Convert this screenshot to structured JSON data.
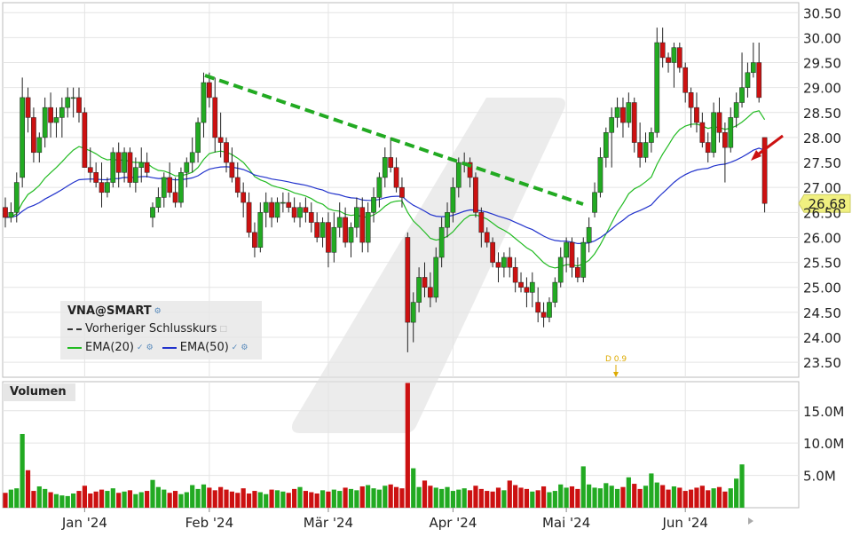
{
  "symbol": "VNA@SMART",
  "legend": {
    "title": "VNA@SMART",
    "items": [
      {
        "label": "Vorheriger Schlusskurs",
        "color": "#333333",
        "style": "dashed"
      },
      {
        "label": "EMA(20)",
        "color": "#22bb22",
        "style": "solid"
      },
      {
        "label": "EMA(50)",
        "color": "#2233cc",
        "style": "solid"
      }
    ]
  },
  "volume_panel_label": "Volumen",
  "colors": {
    "up": "#22aa22",
    "down": "#cc1111",
    "ema20": "#22bb22",
    "ema50": "#2233cc",
    "trend": "#22aa22",
    "arrow": "#cc1111",
    "last_price_bg": "#f0f080",
    "dividend": "#ddaa00"
  },
  "last_price_label": "26.68",
  "dividend_label": "D 0.9",
  "chart_data": {
    "type": "candlestick",
    "price_axis": {
      "ticks": [
        "30.50",
        "30.00",
        "29.50",
        "29.00",
        "28.50",
        "28.00",
        "27.50",
        "27.00",
        "26.50",
        "26.00",
        "25.50",
        "25.00",
        "24.50",
        "24.00",
        "23.50"
      ],
      "range": [
        23.2,
        30.7
      ]
    },
    "volume_axis": {
      "ticks": [
        "15.0M",
        "10.0M",
        "5.0M"
      ],
      "range": [
        0,
        19.5
      ]
    },
    "x_axis": {
      "ticks": [
        "Jan '24",
        "Feb '24",
        "Mär '24",
        "Apr '24",
        "Mai '24",
        "Jun '24"
      ],
      "tick_index": [
        14,
        36,
        57,
        79,
        99,
        120
      ]
    },
    "ohlc": [
      [
        26.6,
        26.8,
        26.2,
        26.4
      ],
      [
        26.4,
        26.7,
        26.3,
        26.5
      ],
      [
        26.5,
        27.3,
        26.3,
        27.1
      ],
      [
        27.2,
        29.2,
        27.0,
        28.8
      ],
      [
        28.8,
        29.0,
        28.1,
        28.4
      ],
      [
        28.4,
        28.6,
        27.5,
        27.7
      ],
      [
        27.7,
        28.1,
        27.5,
        28.0
      ],
      [
        28.0,
        28.8,
        27.8,
        28.6
      ],
      [
        28.6,
        28.9,
        28.0,
        28.3
      ],
      [
        28.3,
        28.6,
        28.0,
        28.4
      ],
      [
        28.4,
        28.8,
        28.0,
        28.6
      ],
      [
        28.6,
        29.0,
        28.4,
        28.8
      ],
      [
        28.8,
        29.0,
        28.4,
        28.8
      ],
      [
        28.8,
        29.0,
        28.3,
        28.5
      ],
      [
        28.5,
        28.6,
        27.4,
        27.4
      ],
      [
        27.4,
        27.8,
        27.1,
        27.3
      ],
      [
        27.3,
        27.5,
        27.0,
        27.1
      ],
      [
        27.1,
        27.5,
        26.6,
        26.9
      ],
      [
        26.9,
        27.2,
        26.8,
        27.1
      ],
      [
        27.1,
        27.8,
        27.0,
        27.7
      ],
      [
        27.7,
        27.9,
        27.0,
        27.3
      ],
      [
        27.3,
        27.8,
        27.1,
        27.7
      ],
      [
        27.7,
        27.8,
        27.0,
        27.1
      ],
      [
        27.1,
        27.6,
        26.9,
        27.4
      ],
      [
        27.4,
        27.8,
        27.1,
        27.5
      ],
      [
        27.5,
        27.7,
        27.2,
        27.3
      ],
      [
        26.4,
        26.7,
        26.2,
        26.6
      ],
      [
        26.6,
        27.0,
        26.5,
        26.8
      ],
      [
        26.8,
        27.3,
        26.6,
        27.2
      ],
      [
        27.2,
        27.5,
        26.8,
        26.9
      ],
      [
        26.9,
        27.2,
        26.6,
        26.7
      ],
      [
        26.7,
        27.4,
        26.6,
        27.3
      ],
      [
        27.3,
        27.6,
        27.0,
        27.5
      ],
      [
        27.5,
        28.0,
        27.3,
        27.7
      ],
      [
        27.7,
        28.4,
        27.5,
        28.3
      ],
      [
        28.3,
        29.3,
        28.0,
        29.1
      ],
      [
        29.1,
        29.3,
        28.6,
        28.8
      ],
      [
        28.8,
        29.2,
        27.7,
        28.0
      ],
      [
        28.0,
        28.5,
        27.6,
        27.9
      ],
      [
        27.9,
        28.0,
        27.3,
        27.5
      ],
      [
        27.5,
        27.8,
        27.1,
        27.2
      ],
      [
        27.2,
        27.5,
        26.8,
        26.9
      ],
      [
        26.9,
        27.1,
        26.4,
        26.7
      ],
      [
        26.7,
        26.9,
        26.0,
        26.1
      ],
      [
        26.1,
        26.3,
        25.6,
        25.8
      ],
      [
        25.8,
        26.7,
        25.7,
        26.5
      ],
      [
        26.5,
        26.9,
        26.2,
        26.7
      ],
      [
        26.7,
        26.8,
        26.2,
        26.4
      ],
      [
        26.4,
        26.8,
        26.3,
        26.7
      ],
      [
        26.7,
        26.9,
        26.5,
        26.7
      ],
      [
        26.7,
        26.9,
        26.5,
        26.6
      ],
      [
        26.6,
        26.8,
        26.3,
        26.4
      ],
      [
        26.4,
        26.7,
        26.2,
        26.6
      ],
      [
        26.6,
        26.8,
        26.3,
        26.5
      ],
      [
        26.5,
        26.7,
        26.1,
        26.3
      ],
      [
        26.3,
        26.5,
        25.9,
        26.0
      ],
      [
        26.0,
        26.4,
        25.8,
        26.3
      ],
      [
        26.3,
        26.5,
        25.4,
        25.7
      ],
      [
        25.7,
        26.5,
        25.5,
        26.2
      ],
      [
        26.2,
        26.7,
        26.0,
        26.4
      ],
      [
        26.4,
        26.6,
        25.8,
        25.9
      ],
      [
        25.9,
        26.3,
        25.6,
        26.2
      ],
      [
        26.2,
        26.8,
        26.0,
        26.6
      ],
      [
        26.6,
        26.8,
        25.7,
        25.9
      ],
      [
        25.9,
        26.7,
        25.7,
        26.5
      ],
      [
        26.5,
        27.0,
        26.3,
        26.8
      ],
      [
        26.8,
        27.3,
        26.6,
        27.2
      ],
      [
        27.2,
        27.8,
        27.0,
        27.6
      ],
      [
        27.6,
        28.0,
        27.3,
        27.4
      ],
      [
        27.4,
        27.6,
        26.9,
        27.0
      ],
      [
        27.0,
        27.2,
        26.6,
        26.8
      ],
      [
        26.0,
        26.1,
        23.7,
        24.3
      ],
      [
        24.3,
        24.9,
        23.9,
        24.7
      ],
      [
        24.7,
        25.4,
        24.5,
        25.2
      ],
      [
        25.2,
        25.5,
        24.8,
        25.0
      ],
      [
        25.0,
        25.3,
        24.6,
        24.8
      ],
      [
        24.8,
        25.8,
        24.7,
        25.6
      ],
      [
        25.6,
        26.4,
        25.4,
        26.2
      ],
      [
        26.2,
        26.7,
        26.0,
        26.5
      ],
      [
        26.5,
        27.2,
        26.3,
        27.0
      ],
      [
        27.0,
        27.6,
        26.8,
        27.5
      ],
      [
        27.5,
        27.7,
        27.3,
        27.5
      ],
      [
        27.5,
        27.6,
        27.0,
        27.2
      ],
      [
        27.2,
        27.3,
        26.4,
        26.5
      ],
      [
        26.5,
        26.6,
        25.8,
        26.1
      ],
      [
        26.1,
        26.2,
        25.8,
        25.9
      ],
      [
        25.9,
        26.0,
        25.4,
        25.5
      ],
      [
        25.5,
        25.7,
        25.1,
        25.4
      ],
      [
        25.4,
        25.7,
        25.2,
        25.6
      ],
      [
        25.6,
        25.8,
        25.2,
        25.4
      ],
      [
        25.4,
        25.6,
        24.9,
        25.1
      ],
      [
        25.1,
        25.3,
        24.9,
        25.0
      ],
      [
        25.0,
        25.2,
        24.6,
        24.9
      ],
      [
        24.9,
        25.3,
        24.6,
        25.1
      ],
      [
        24.7,
        25.0,
        24.3,
        24.5
      ],
      [
        24.5,
        24.7,
        24.2,
        24.4
      ],
      [
        24.4,
        24.8,
        24.3,
        24.7
      ],
      [
        24.7,
        25.2,
        24.6,
        25.1
      ],
      [
        25.1,
        25.8,
        25.0,
        25.6
      ],
      [
        25.6,
        26.0,
        25.3,
        25.9
      ],
      [
        25.9,
        26.0,
        25.2,
        25.4
      ],
      [
        25.4,
        25.6,
        25.1,
        25.2
      ],
      [
        25.2,
        26.0,
        25.1,
        25.9
      ],
      [
        25.9,
        26.4,
        25.7,
        26.2
      ],
      [
        26.5,
        27.1,
        26.4,
        26.9
      ],
      [
        26.9,
        27.8,
        26.8,
        27.6
      ],
      [
        27.6,
        28.2,
        27.4,
        28.1
      ],
      [
        28.1,
        28.6,
        27.4,
        28.4
      ],
      [
        28.4,
        28.8,
        28.2,
        28.6
      ],
      [
        28.6,
        28.8,
        28.0,
        28.3
      ],
      [
        28.3,
        28.9,
        28.2,
        28.7
      ],
      [
        28.7,
        28.8,
        27.7,
        27.9
      ],
      [
        27.9,
        28.3,
        27.4,
        27.6
      ],
      [
        27.6,
        28.1,
        27.5,
        27.9
      ],
      [
        27.9,
        28.2,
        27.7,
        28.1
      ],
      [
        28.1,
        30.2,
        28.0,
        29.9
      ],
      [
        29.9,
        30.2,
        29.4,
        29.6
      ],
      [
        29.6,
        29.7,
        29.3,
        29.5
      ],
      [
        29.5,
        29.9,
        29.0,
        29.8
      ],
      [
        29.8,
        29.9,
        29.3,
        29.4
      ],
      [
        29.4,
        29.5,
        28.7,
        28.9
      ],
      [
        28.9,
        29.0,
        28.2,
        28.6
      ],
      [
        28.6,
        28.9,
        28.1,
        28.3
      ],
      [
        28.3,
        28.5,
        27.8,
        27.9
      ],
      [
        27.9,
        28.1,
        27.5,
        27.7
      ],
      [
        27.7,
        28.7,
        27.6,
        28.5
      ],
      [
        28.5,
        28.8,
        27.9,
        28.1
      ],
      [
        28.1,
        28.3,
        27.1,
        27.8
      ],
      [
        27.8,
        28.6,
        27.7,
        28.4
      ],
      [
        28.4,
        28.9,
        28.2,
        28.7
      ],
      [
        28.7,
        29.7,
        28.6,
        29.0
      ],
      [
        29.0,
        29.5,
        28.8,
        29.3
      ],
      [
        29.3,
        29.9,
        29.2,
        29.5
      ],
      [
        29.5,
        29.9,
        28.7,
        28.8
      ],
      [
        28.0,
        28.0,
        26.5,
        26.68
      ]
    ],
    "volume": [
      2.3,
      2.8,
      3.0,
      11.4,
      5.8,
      2.6,
      3.3,
      2.9,
      2.4,
      2.1,
      1.9,
      1.8,
      2.2,
      2.6,
      3.4,
      2.2,
      2.5,
      2.8,
      2.6,
      3.0,
      2.3,
      2.5,
      2.7,
      2.1,
      2.4,
      2.6,
      4.3,
      3.2,
      2.8,
      2.3,
      2.6,
      2.1,
      2.4,
      3.5,
      2.9,
      3.6,
      3.1,
      2.7,
      3.2,
      2.8,
      2.5,
      2.3,
      3.0,
      2.2,
      2.6,
      2.4,
      2.1,
      2.8,
      2.7,
      2.5,
      2.3,
      2.9,
      3.2,
      2.6,
      2.4,
      2.2,
      2.7,
      2.5,
      2.8,
      2.6,
      3.1,
      2.9,
      2.7,
      3.3,
      3.5,
      3.0,
      2.8,
      3.4,
      3.6,
      3.2,
      3.0,
      19.3,
      6.1,
      3.2,
      4.2,
      3.4,
      3.1,
      2.9,
      3.2,
      2.6,
      2.8,
      3.0,
      2.7,
      3.4,
      2.9,
      2.6,
      2.5,
      3.1,
      2.7,
      4.2,
      3.5,
      3.1,
      2.9,
      2.5,
      2.7,
      3.3,
      2.4,
      2.6,
      3.6,
      3.1,
      3.3,
      2.9,
      6.4,
      3.6,
      3.1,
      3.0,
      3.8,
      3.4,
      2.9,
      3.2,
      4.7,
      3.7,
      2.9,
      3.4,
      5.3,
      3.9,
      3.5,
      2.8,
      3.3,
      3.1,
      2.6,
      2.8,
      3.1,
      3.4,
      2.7,
      3.0,
      3.2,
      2.5,
      3.0,
      4.5,
      6.7
    ]
  }
}
